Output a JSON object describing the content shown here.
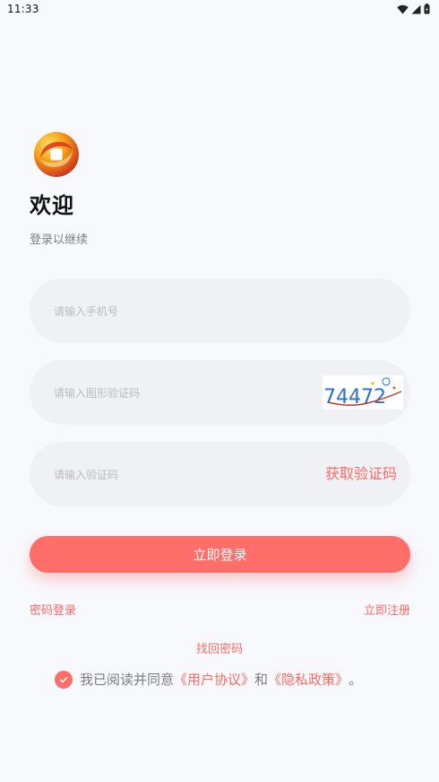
{
  "status_bar": {
    "time": "11:33",
    "icons": [
      "wifi-icon",
      "signal-icon",
      "battery-icon"
    ]
  },
  "branding": {
    "logo_icon": "brand-logo"
  },
  "header": {
    "title": "欢迎",
    "subtitle": "登录以继续"
  },
  "form": {
    "phone_placeholder": "请输入手机号",
    "captcha_placeholder": "请输入图形验证码",
    "captcha_text": "74472",
    "code_placeholder": "请输入验证码",
    "get_code_label": "获取验证码",
    "login_label": "立即登录"
  },
  "links": {
    "password_login": "密码登录",
    "register": "立即注册",
    "forgot_password": "找回密码"
  },
  "agreement": {
    "checked": true,
    "prefix": "我已阅读并同意",
    "user_agreement": "《用户协议》",
    "and": "和",
    "privacy_policy": "《隐私政策》",
    "suffix": "。"
  },
  "colors": {
    "accent": "#ff6e68",
    "background": "#f8f9fd",
    "input_background": "#eff1f5"
  }
}
